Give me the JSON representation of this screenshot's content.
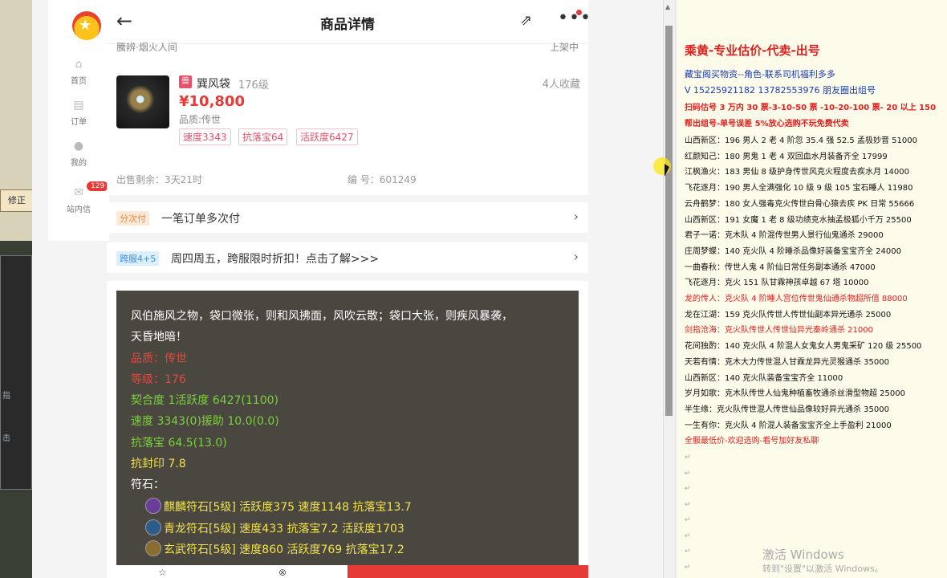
{
  "left_desktop": {
    "fix_label": "修正",
    "panel_t1": "指",
    "panel_t2": "击"
  },
  "sidebar": {
    "items": [
      {
        "label": "首页",
        "icon": "home-icon"
      },
      {
        "label": "订单",
        "icon": "order-icon"
      },
      {
        "label": "我的",
        "icon": "user-icon"
      },
      {
        "label": "站内信",
        "icon": "mail-icon",
        "badge": "129"
      }
    ]
  },
  "header": {
    "title": "商品详情",
    "back": "←",
    "share": "⇗",
    "more": "•••"
  },
  "cut_top": {
    "left": "騰辨·烟火人间",
    "right": "上架中"
  },
  "item": {
    "tag": "兽",
    "name": "巽风袋",
    "level": "176级",
    "favorites": "4人收藏",
    "price": "¥10,800",
    "quality": "品质:传世",
    "chips": [
      "速度3343",
      "抗落宝64",
      "活跃度6427"
    ]
  },
  "meta": {
    "remaining": "出售剩余：3天21时",
    "number": "编 号：601249"
  },
  "rows": [
    {
      "pill": "分次付",
      "text": "一笔订单多次付"
    },
    {
      "pill": "跨服4+5",
      "text": "周四周五，跨服限时折扣！点击了解>>>"
    }
  ],
  "description": {
    "intro_1": "风伯施风之物，袋口微张，则和风拂面，风吹云散；袋口大张，则疾风暴袭，",
    "intro_2": "天昏地暗！",
    "quality": "品质：传世",
    "level": "等级：176",
    "fit": "契合度     1活跃度  6427(1100)",
    "speed": "速度     3343(0)援助     10.0(0.0)",
    "anti_loot": "抗落宝  64.5(13.0)",
    "anti_seal": "抗封印 7.8",
    "runes_label": "符石：",
    "runes": [
      "麒麟符石[5级] 活跃度375 速度1148 抗落宝13.7",
      "青龙符石[5级] 速度433 抗落宝7.2 活跃度1703",
      "玄武符石[5级] 速度860 活跃度769 抗落宝17.2"
    ]
  },
  "bottom": {
    "fav_icon": "☆",
    "svc_icon": "⊗"
  },
  "notes": {
    "title": "乘黄-专业估价-代卖-出号",
    "lines_blue": [
      "藏宝阁买物资--角色-联系司机福利多多",
      "V 15225921182   13782553976 朋友圈出组号"
    ],
    "lines_boldred": [
      "扫码估号 3 万内 30 票-3-10-50 票  -10-20-100 票- 20 以上 150",
      "帮出组号-单号误差 5%放心选购不玩免费代卖"
    ],
    "list": [
      {
        "t": "山西新区：196 男人 2 老 4 阶忽 35.4 强 52.5 孟极妙音 51000",
        "c": "n"
      },
      {
        "t": "红颜知己：180 男鬼 1 老 4 双回血水月装备齐全 17999",
        "c": "n"
      },
      {
        "t": "江枫渔火：183 男仙 8 级护身传世风克火程度去疾水月 14000",
        "c": "n"
      },
      {
        "t": "飞花逐月：190 男人全满强化 10 级 9 级 105 宝石睡人 11980",
        "c": "n"
      },
      {
        "t": "云舟鹤梦：180 女人强毒克火传世白骨心猿去疾 PK 日常 55666",
        "c": "n"
      },
      {
        "t": "山西新区：191 女魔 1 老 8 级功绩克水抽孟极狐小千万 25500",
        "c": "n"
      },
      {
        "t": "君子一诺：克木队 4 阶混传世男人景行仙鬼通杀 29000",
        "c": "n"
      },
      {
        "t": "庄周梦蝶：140 克火队 4 阶睡杀品像好装备宝宝齐全 24000",
        "c": "n"
      },
      {
        "t": "一曲春秋：传世人鬼 4 阶仙日常任务副本通杀 47000",
        "c": "n"
      },
      {
        "t": "飞花逐月：克火 151 队甘霖神孩卓越 67 塔 10000",
        "c": "n"
      },
      {
        "t": "龙的传人：克火队 4 阶睡人宫位传世鬼仙通杀物超所值 88000",
        "c": "r"
      },
      {
        "t": "龙在江湖：159 克火队传世人传世仙副本异光通杀 25000",
        "c": "n"
      },
      {
        "t": "剑指沧海：克火队传世人传世仙异光秦岭通杀 21000",
        "c": "r"
      },
      {
        "t": "花间独酌：140 克火队 4 阶混人女鬼女人男鬼采矿 120 级 25500",
        "c": "n"
      },
      {
        "t": "天若有情：克木大力传世混人甘霖龙异光灵猴通杀 35000",
        "c": "n"
      },
      {
        "t": "山西新区：140 克火队装备宝宝齐全 11000",
        "c": "n"
      },
      {
        "t": "岁月如歌：克木队传世人仙鬼种植畜牧通杀丝滑型物超 25000",
        "c": "n"
      },
      {
        "t": "半生缘：克火队传世混人传世仙品像较好异光通杀 35000",
        "c": "n"
      },
      {
        "t": "一生有你：克火队 4 阶混人装备宝宝齐全上手盈利 21000",
        "c": "n"
      },
      {
        "t": "全服最低价-欢迎选购-看号加好友私聊",
        "c": "r"
      }
    ],
    "para_mark": "↵"
  },
  "watermark": {
    "line1": "激活 Windows",
    "line2": "转到\"设置\"以激活 Windows。"
  }
}
